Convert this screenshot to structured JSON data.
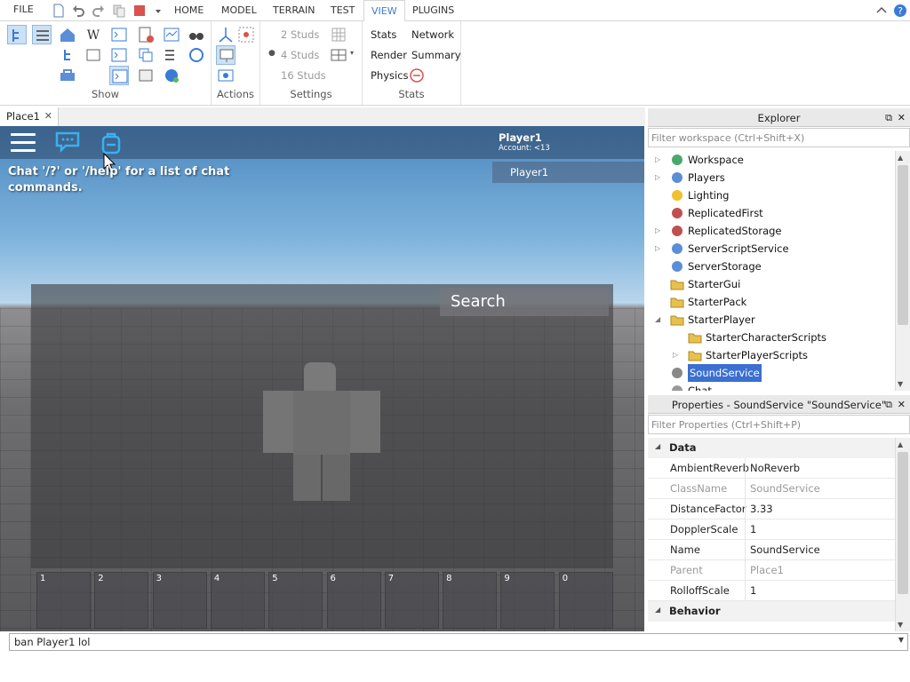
{
  "menubar": {
    "file": "FILE",
    "tabs": [
      "HOME",
      "MODEL",
      "TERRAIN",
      "TEST",
      "VIEW",
      "PLUGINS"
    ],
    "active_tab": "VIEW"
  },
  "ribbon": {
    "groups": {
      "show": "Show",
      "actions": "Actions",
      "settings": "Settings",
      "stats": "Stats"
    },
    "settings": {
      "grid_2": "2 Studs",
      "grid_4": "4 Studs",
      "grid_16": "16 Studs"
    },
    "stats": {
      "stats": "Stats",
      "network": "Network",
      "render": "Render",
      "summary": "Summary",
      "physics": "Physics"
    }
  },
  "document_tab": {
    "label": "Place1",
    "close": "✕"
  },
  "viewport": {
    "player_name": "Player1",
    "account": "Account: <13",
    "player_list_entry": "Player1",
    "chat_message": "Chat '/?' or '/help' for a list of chat commands.",
    "search": "Search",
    "hotbar": [
      "1",
      "2",
      "3",
      "4",
      "5",
      "6",
      "7",
      "8",
      "9",
      "0"
    ]
  },
  "explorer": {
    "title": "Explorer",
    "filter_placeholder": "Filter workspace (Ctrl+Shift+X)",
    "items": [
      {
        "label": "Workspace",
        "icon": "workspace-icon"
      },
      {
        "label": "Players",
        "icon": "players-icon"
      },
      {
        "label": "Lighting",
        "icon": "lightbulb-icon"
      },
      {
        "label": "ReplicatedFirst",
        "icon": "replicated-first-icon"
      },
      {
        "label": "ReplicatedStorage",
        "icon": "replicated-storage-icon"
      },
      {
        "label": "ServerScriptService",
        "icon": "server-script-service-icon"
      },
      {
        "label": "ServerStorage",
        "icon": "server-storage-icon"
      },
      {
        "label": "StarterGui",
        "icon": "folder-icon"
      },
      {
        "label": "StarterPack",
        "icon": "folder-icon"
      },
      {
        "label": "StarterPlayer",
        "icon": "folder-icon"
      },
      {
        "label": "StarterCharacterScripts",
        "icon": "folder-icon"
      },
      {
        "label": "StarterPlayerScripts",
        "icon": "folder-icon"
      },
      {
        "label": "SoundService",
        "icon": "sound-service-icon"
      },
      {
        "label": "Chat",
        "icon": "chat-icon"
      }
    ],
    "selected": "SoundService"
  },
  "properties": {
    "title": "Properties - SoundService \"SoundService\"",
    "filter_placeholder": "Filter Properties (Ctrl+Shift+P)",
    "categories": {
      "data": "Data",
      "behavior": "Behavior"
    },
    "rows": [
      {
        "name": "AmbientReverb",
        "value": "NoReverb"
      },
      {
        "name": "ClassName",
        "value": "SoundService"
      },
      {
        "name": "DistanceFactor",
        "value": "3.33"
      },
      {
        "name": "DopplerScale",
        "value": "1"
      },
      {
        "name": "Name",
        "value": "SoundService"
      },
      {
        "name": "Parent",
        "value": "Place1"
      },
      {
        "name": "RolloffScale",
        "value": "1"
      }
    ]
  },
  "command_bar": {
    "value": "ban Player1 lol"
  },
  "colors": {
    "accent": "#3a7bd5",
    "selection": "#3b6fd1",
    "sky": "#7eb3dc"
  }
}
